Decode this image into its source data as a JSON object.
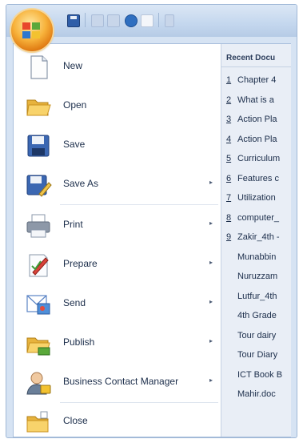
{
  "office_menu": {
    "items": [
      {
        "label": "New",
        "icon": "new-document-icon",
        "has_submenu": false
      },
      {
        "label": "Open",
        "icon": "open-folder-icon",
        "has_submenu": false
      },
      {
        "label": "Save",
        "icon": "save-disk-icon",
        "has_submenu": false
      },
      {
        "label": "Save As",
        "icon": "save-as-icon",
        "has_submenu": true
      },
      {
        "label": "Print",
        "icon": "printer-icon",
        "has_submenu": true
      },
      {
        "label": "Prepare",
        "icon": "prepare-icon",
        "has_submenu": true
      },
      {
        "label": "Send",
        "icon": "send-icon",
        "has_submenu": true
      },
      {
        "label": "Publish",
        "icon": "publish-icon",
        "has_submenu": true
      },
      {
        "label": "Business Contact Manager",
        "icon": "contact-manager-icon",
        "has_submenu": true
      },
      {
        "label": "Close",
        "icon": "close-folder-icon",
        "has_submenu": false
      }
    ],
    "submenu_arrow": "▸"
  },
  "recent_documents": {
    "title": "Recent Docu",
    "items": [
      {
        "num": "1",
        "name": "Chapter 4"
      },
      {
        "num": "2",
        "name": "What is a"
      },
      {
        "num": "3",
        "name": "Action Pla"
      },
      {
        "num": "4",
        "name": "Action Pla"
      },
      {
        "num": "5",
        "name": "Curriculum"
      },
      {
        "num": "6",
        "name": "Features c"
      },
      {
        "num": "7",
        "name": "Utilization"
      },
      {
        "num": "8",
        "name": "computer_"
      },
      {
        "num": "9",
        "name": "Zakir_4th -"
      },
      {
        "num": "",
        "name": "Munabbin"
      },
      {
        "num": "",
        "name": "Nuruzzam"
      },
      {
        "num": "",
        "name": "Lutfur_4th"
      },
      {
        "num": "",
        "name": "4th Grade"
      },
      {
        "num": "",
        "name": "Tour dairy"
      },
      {
        "num": "",
        "name": "Tour Diary"
      },
      {
        "num": "",
        "name": "ICT Book B"
      },
      {
        "num": "",
        "name": "Mahir.doc"
      }
    ]
  },
  "quick_access": {
    "icons": [
      "save-icon",
      "undo-icon",
      "redo-icon",
      "print-preview-icon",
      "customize-icon"
    ]
  },
  "colors": {
    "accent_orange": "#f7b23b",
    "menu_border": "#a9bfdc",
    "panel_bg": "#e9eef6"
  }
}
